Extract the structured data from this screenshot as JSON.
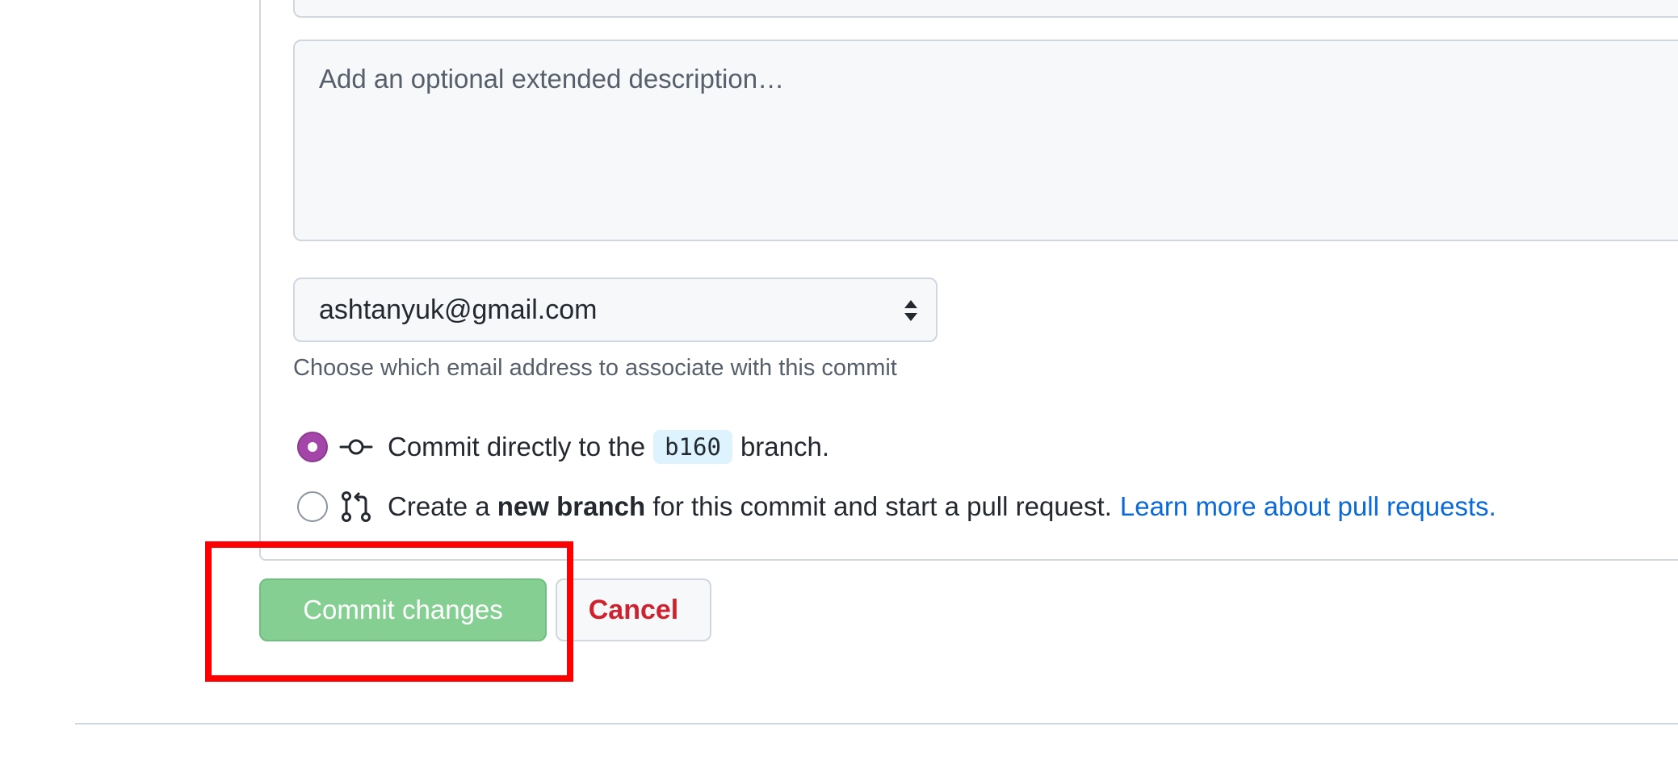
{
  "commit_form": {
    "description_placeholder": "Add an optional extended description…",
    "email": {
      "selected": "ashtanyuk@gmail.com",
      "hint": "Choose which email address to associate with this commit"
    },
    "options": {
      "direct": {
        "selected": true,
        "icon": "git-commit-icon",
        "prefix": "Commit directly to the",
        "branch": "b160",
        "suffix": "branch."
      },
      "new_branch": {
        "selected": false,
        "icon": "git-pull-request-icon",
        "prefix": "Create a",
        "bold": "new branch",
        "suffix": "for this commit and start a pull request.",
        "link": "Learn more about pull requests."
      }
    }
  },
  "actions": {
    "commit_label": "Commit changes",
    "cancel_label": "Cancel"
  },
  "colors": {
    "radio_selected": "#a446a9",
    "commit_button": "#86cf93",
    "cancel_text": "#cf222e",
    "link": "#0969da",
    "highlight": "#ff0000"
  }
}
